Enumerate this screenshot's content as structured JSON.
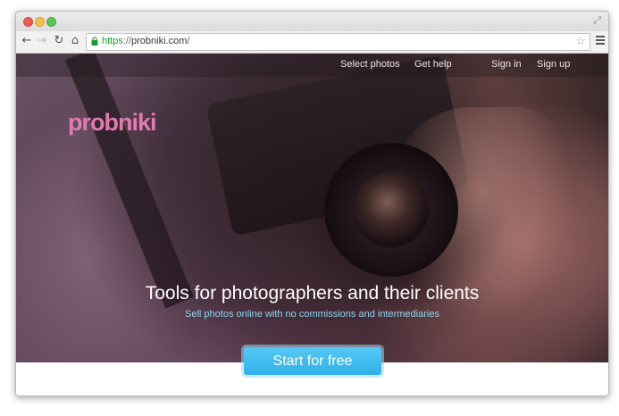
{
  "browser": {
    "url_scheme": "https",
    "url_separator": "://",
    "url_host": "probniki.com",
    "url_path": "/"
  },
  "site": {
    "logo": "probniki",
    "nav": [
      {
        "label": "Select photos"
      },
      {
        "label": "Get help"
      },
      {
        "label": "Sign in"
      },
      {
        "label": "Sign up"
      }
    ],
    "headline": "Tools for photographers and their clients",
    "subheadline": "Sell photos online with no commissions and intermediaries",
    "cta_label": "Start for free"
  },
  "colors": {
    "logo": "#e27ab2",
    "cta": "#3ab8ee",
    "subheadline": "#8ed6f2",
    "secure_url": "#1a9e2e"
  },
  "icons": [
    "back-icon",
    "forward-icon",
    "reload-icon",
    "home-icon",
    "lock-icon",
    "star-icon",
    "menu-icon"
  ]
}
